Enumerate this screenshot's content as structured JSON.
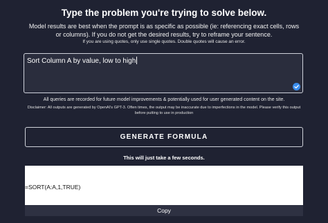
{
  "header": {
    "title": "Type the problem you're trying to solve below.",
    "subtitle": "Model results are best when the prompt is as specific as possible (ie: referencing exact cells, rows or columns). If you do not get the desired results, try to reframe your sentence.",
    "quote_note": "If you are using quotes, only use single quotes. Double quotes will cause an error."
  },
  "prompt": {
    "value": "Sort Column A by value, low to high"
  },
  "notice": "All queries are recorded for future model improvements & potentially used for user generated content on the site.",
  "disclaimer": "Disclaimer: All outputs are generated by OpenAI's GPT-3. Often times, the output may be inaccurate due to imperfections in the model. Please verify this output before putting to use in production",
  "generate_button_label": "GENERATE FORMULA",
  "wait_text": "This will just take a few seconds.",
  "result": {
    "formula": "=SORT(A:A,1,TRUE)"
  },
  "copy_button_label": "Copy",
  "colors": {
    "background": "#1f2232",
    "check_badge": "#3b8ded"
  },
  "icons": {
    "check": "check-circle-icon"
  }
}
